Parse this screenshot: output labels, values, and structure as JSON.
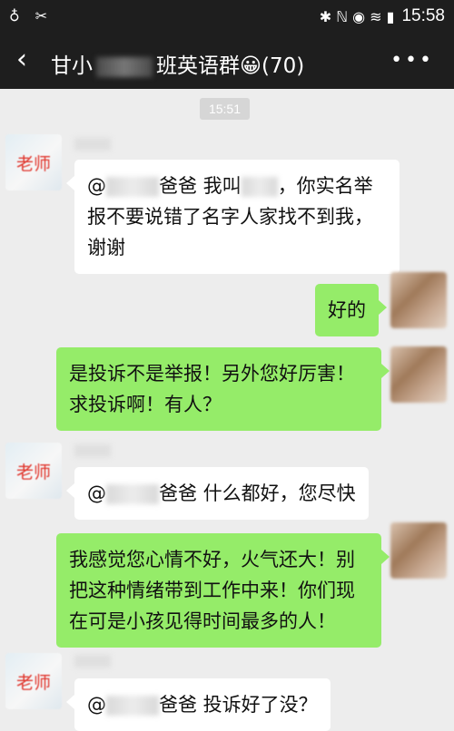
{
  "status": {
    "time": "15:58",
    "left_icons": "♁ ✂",
    "right_icons": "✱ ℕ ◉ ≋ ▮"
  },
  "nav": {
    "back": "‹",
    "title_prefix": "甘小",
    "title_suffix": "班英语群😀(70)",
    "more": "•••"
  },
  "chat": {
    "timestamp": "15:51",
    "teacher_label": "老师",
    "messages": [
      {
        "side": "left",
        "pre": "@",
        "mid": "爸爸  我叫",
        "post": "，你实名举报不要说错了名字人家找不到我，谢谢"
      },
      {
        "side": "right",
        "text": "好的"
      },
      {
        "side": "right",
        "text": "是投诉不是举报！另外您好厉害！求投诉啊！有人？"
      },
      {
        "side": "left",
        "pre": "@",
        "post": "爸爸  什么都好，您尽快"
      },
      {
        "side": "right",
        "text": "我感觉您心情不好，火气还大！别把这种情绪带到工作中来！你们现在可是小孩见得时间最多的人！"
      },
      {
        "side": "left",
        "pre": "@",
        "post": "爸爸  投诉好了没？"
      }
    ]
  }
}
